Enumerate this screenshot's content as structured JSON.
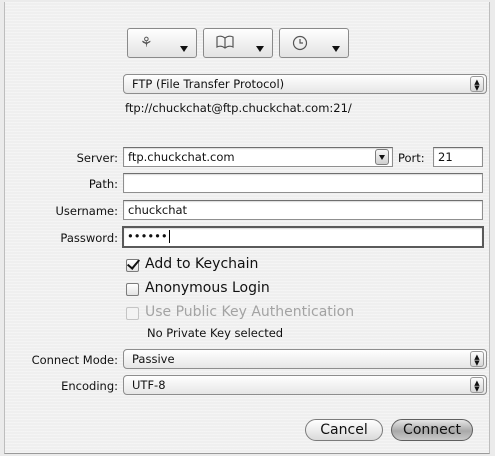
{
  "toolbar": {
    "buttons": [
      {
        "icon": "bonjour-icon",
        "glyph": "⚘"
      },
      {
        "icon": "bookmarks-icon",
        "glyph": "📖"
      },
      {
        "icon": "history-icon",
        "glyph": "◷"
      }
    ]
  },
  "protocol": {
    "selected": "FTP (File Transfer Protocol)"
  },
  "url": "ftp://chuckchat@ftp.chuckchat.com:21/",
  "form": {
    "server_label": "Server:",
    "server_value": "ftp.chuckchat.com",
    "port_label": "Port:",
    "port_value": "21",
    "path_label": "Path:",
    "path_value": "",
    "username_label": "Username:",
    "username_value": "chuckchat",
    "password_label": "Password:",
    "password_value": "••••••"
  },
  "options": {
    "keychain_label": "Add to Keychain",
    "keychain_checked": true,
    "anonymous_label": "Anonymous Login",
    "anonymous_checked": false,
    "pubkey_label": "Use Public Key Authentication",
    "pubkey_checked": false,
    "pubkey_status": "No Private Key selected"
  },
  "connect_mode": {
    "label": "Connect Mode:",
    "selected": "Passive"
  },
  "encoding": {
    "label": "Encoding:",
    "selected": "UTF-8"
  },
  "actions": {
    "cancel_label": "Cancel",
    "connect_label": "Connect"
  }
}
